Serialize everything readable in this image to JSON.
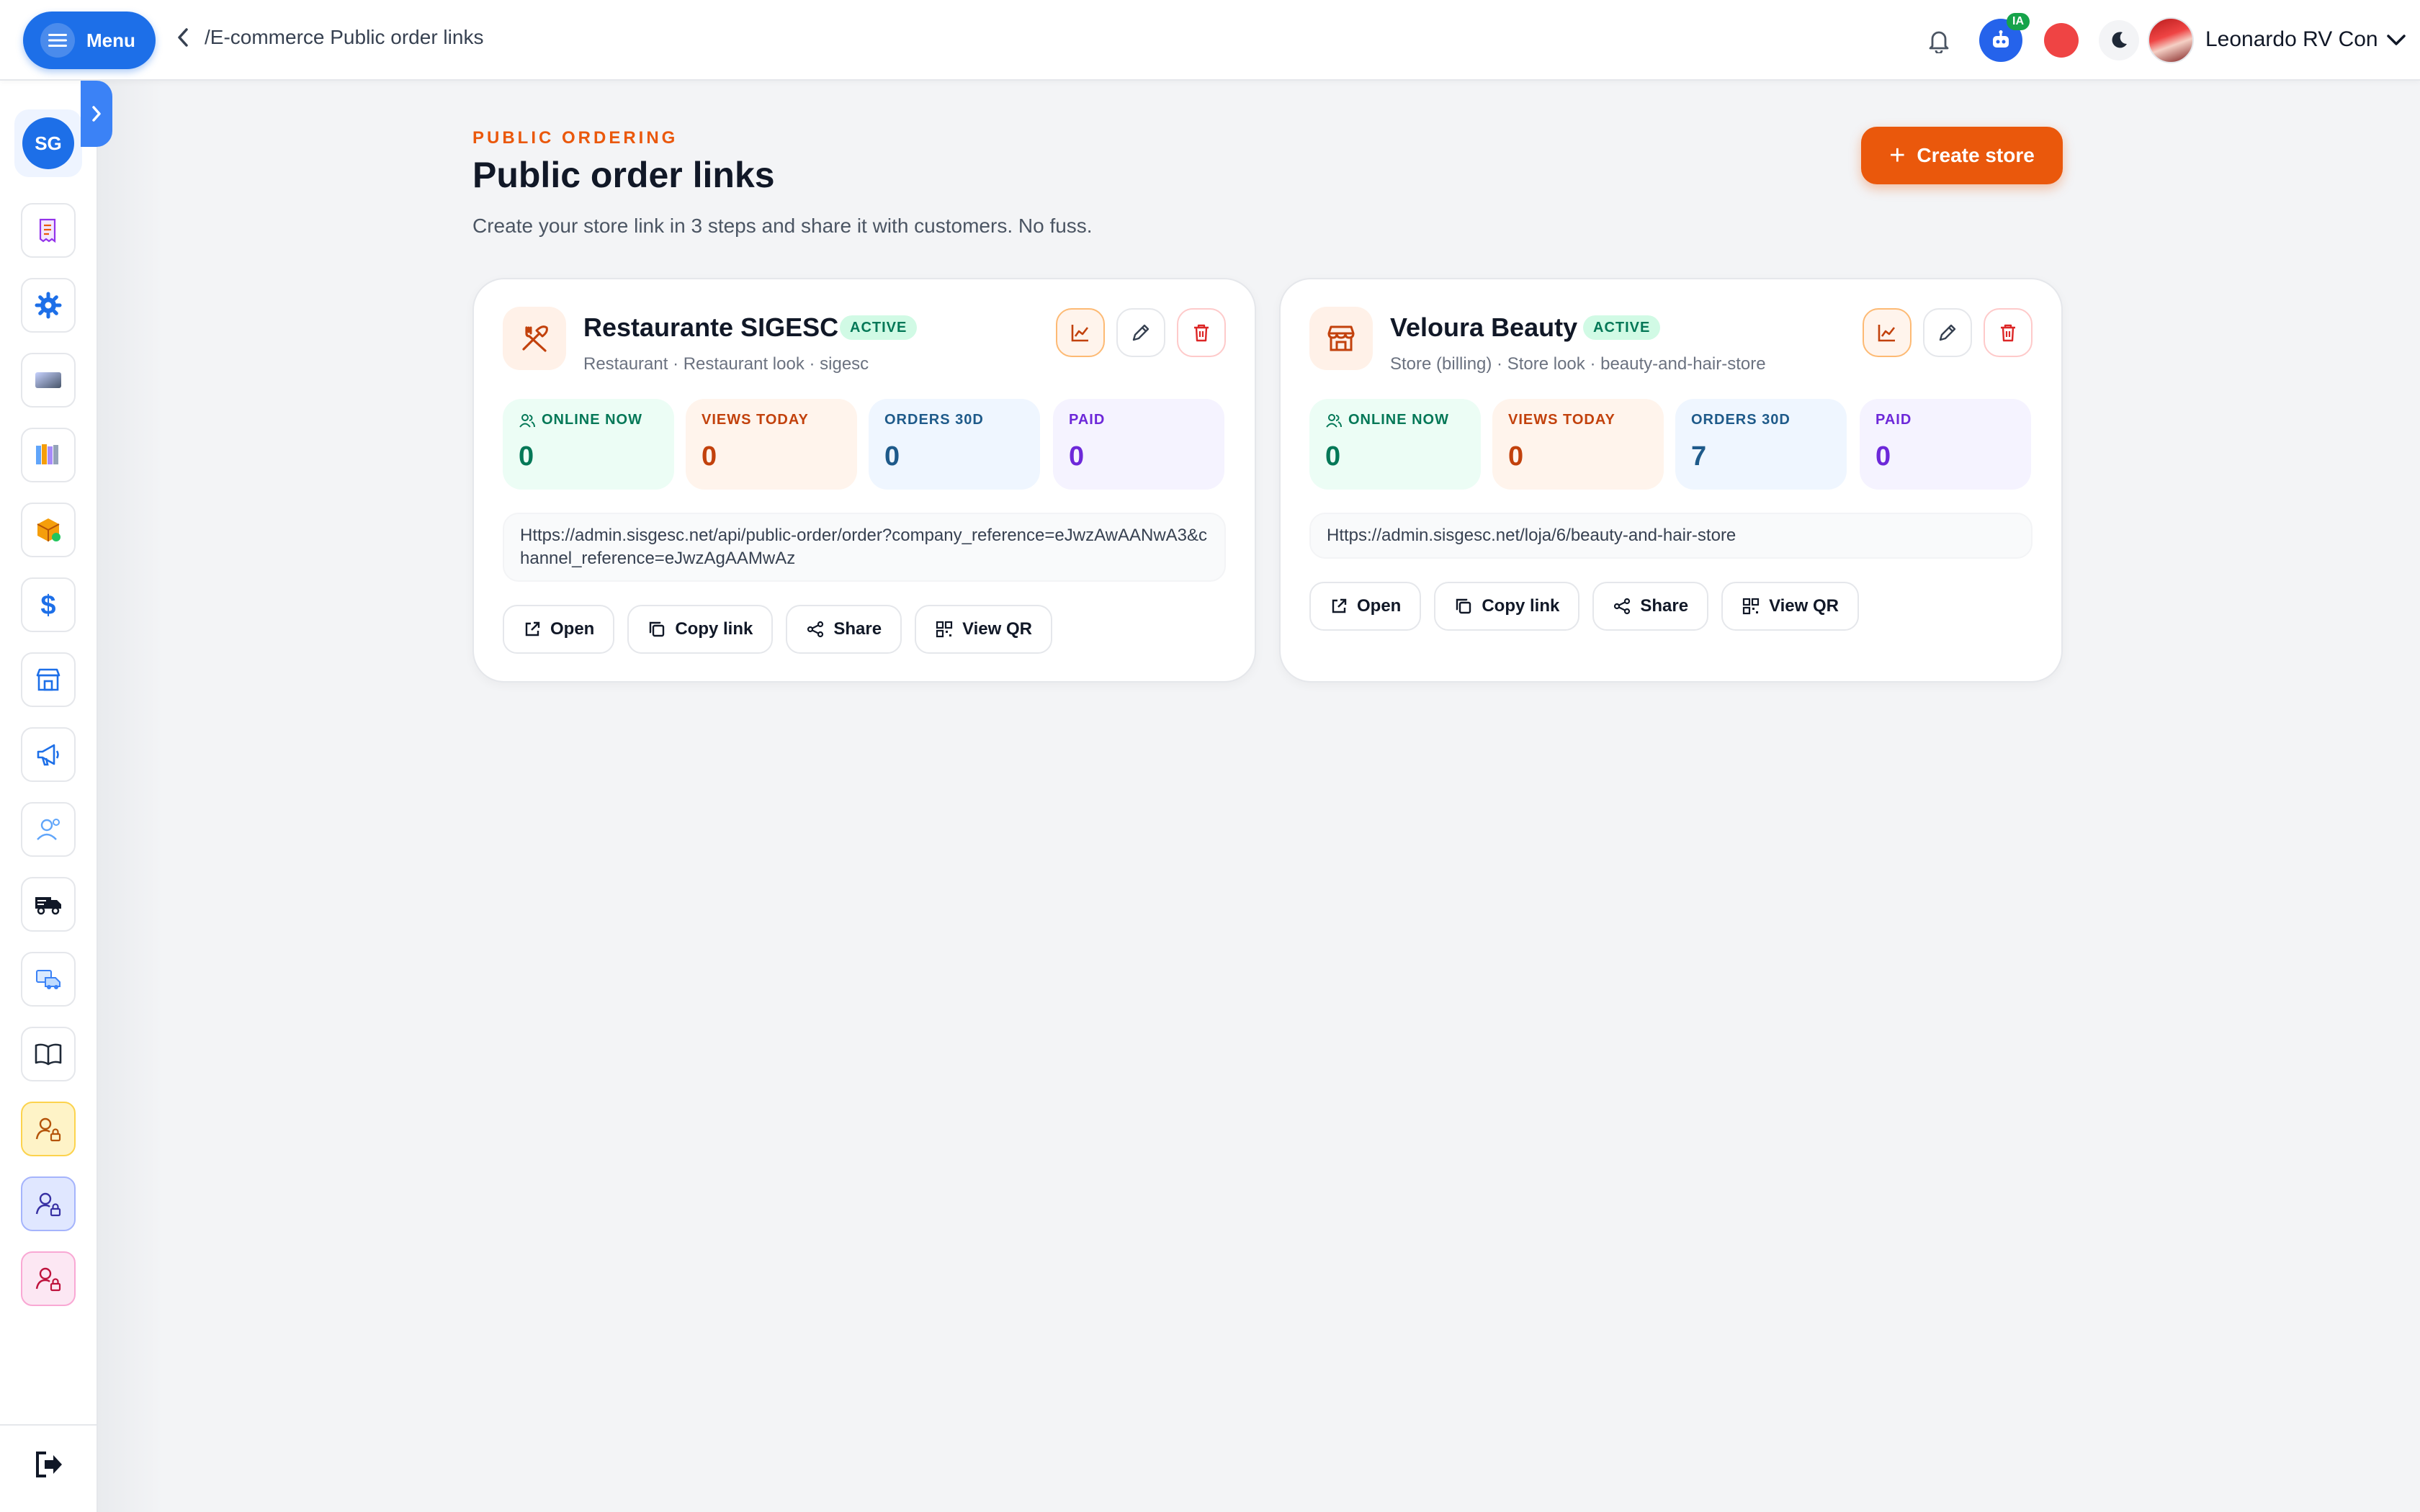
{
  "topbar": {
    "menu_label": "Menu",
    "breadcrumb": "/E-commerce Public order links",
    "ai_badge": "IA",
    "user_name": "Leonardo RV Con"
  },
  "sidebar": {
    "logo_initials": "SG",
    "items": [
      {
        "icon": "receipt-icon"
      },
      {
        "icon": "gear-icon"
      },
      {
        "icon": "gradient-card-icon"
      },
      {
        "icon": "books-icon"
      },
      {
        "icon": "box-icon"
      },
      {
        "icon": "dollar-icon"
      },
      {
        "icon": "store-icon"
      },
      {
        "icon": "megaphone-icon"
      },
      {
        "icon": "support-icon"
      },
      {
        "icon": "truck-icon"
      },
      {
        "icon": "delivery-icon"
      },
      {
        "icon": "book-open-icon"
      },
      {
        "icon": "user-lock-icon"
      },
      {
        "icon": "user-lock-icon"
      },
      {
        "icon": "user-lock-icon"
      }
    ],
    "logout_icon": "logout-icon"
  },
  "page": {
    "eyebrow": "PUBLIC ORDERING",
    "title": "Public order links",
    "subtitle": "Create your store link in 3 steps and share it with customers. No fuss.",
    "create_button": "Create store"
  },
  "stores": [
    {
      "name": "Restaurante SIGESC",
      "status": "ACTIVE",
      "meta": "Restaurant · Restaurant look · sigesc",
      "icon": "utensils-icon",
      "stats": {
        "online_label": "ONLINE NOW",
        "online": "0",
        "views_label": "VIEWS TODAY",
        "views": "0",
        "orders_label": "ORDERS 30D",
        "orders": "0",
        "paid_label": "PAID",
        "paid": "0"
      },
      "url": "Https://admin.sisgesc.net/api/public-order/order?company_reference=eJwzAwAANwA3&channel_reference=eJwzAgAAMwAz",
      "buttons": {
        "open": "Open",
        "copy": "Copy link",
        "share": "Share",
        "qr": "View QR"
      }
    },
    {
      "name": "Veloura Beauty",
      "status": "ACTIVE",
      "meta": "Store (billing) · Store look · beauty-and-hair-store",
      "icon": "storefront-icon",
      "stats": {
        "online_label": "ONLINE NOW",
        "online": "0",
        "views_label": "VIEWS TODAY",
        "views": "0",
        "orders_label": "ORDERS 30D",
        "orders": "7",
        "paid_label": "PAID",
        "paid": "0"
      },
      "url": "Https://admin.sisgesc.net/loja/6/beauty-and-hair-store",
      "buttons": {
        "open": "Open",
        "copy": "Copy link",
        "share": "Share",
        "qr": "View QR"
      }
    }
  ],
  "colors": {
    "accent": "#ea580c",
    "primary": "#1d6fe8",
    "active_badge": "#d1fae5"
  }
}
